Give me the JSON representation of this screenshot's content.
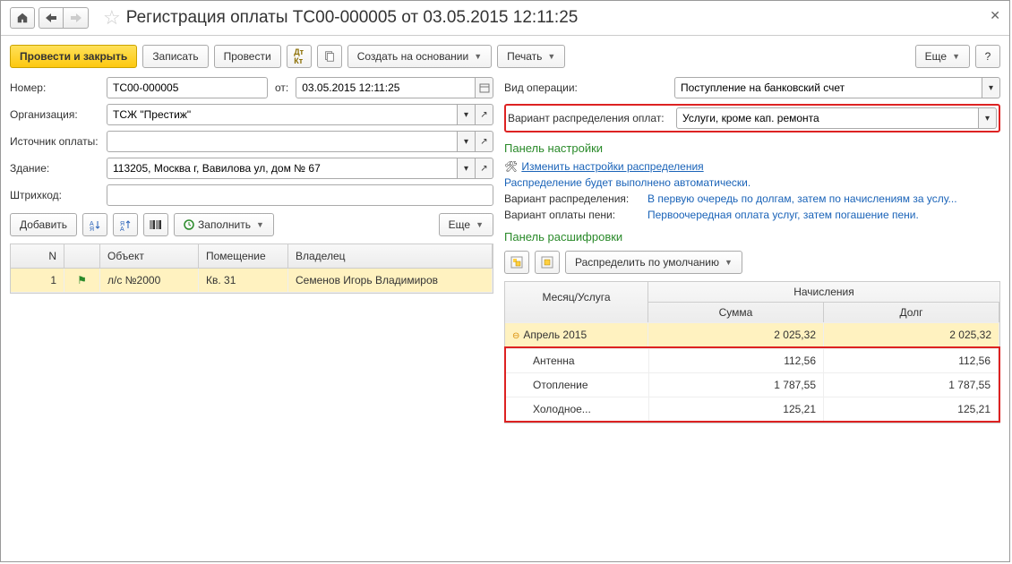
{
  "title": "Регистрация оплаты ТС00-000005 от 03.05.2015 12:11:25",
  "toolbar": {
    "run_close": "Провести и закрыть",
    "save": "Записать",
    "run": "Провести",
    "create_based": "Создать на основании",
    "print": "Печать",
    "more": "Еще"
  },
  "form": {
    "number_label": "Номер:",
    "number": "ТС00-000005",
    "from": "от:",
    "date": "03.05.2015 12:11:25",
    "op_type_label": "Вид операции:",
    "op_type": "Поступление на банковский счет",
    "org_label": "Организация:",
    "org": "ТСЖ \"Престиж\"",
    "dist_label": "Вариант распределения оплат:",
    "dist": "Услуги, кроме кап. ремонта",
    "source_label": "Источник оплаты:",
    "building_label": "Здание:",
    "building": "113205, Москва г, Вавилова ул, дом № 67",
    "barcode_label": "Штрихкод:"
  },
  "left_toolbar": {
    "add": "Добавить",
    "fill": "Заполнить",
    "more": "Еще"
  },
  "left_grid": {
    "cols": {
      "n": "N",
      "obj": "Объект",
      "room": "Помещение",
      "owner": "Владелец"
    },
    "rows": [
      {
        "n": "1",
        "obj": "л/с №2000",
        "room": "Кв. 31",
        "owner": "Семенов Игорь Владимиров"
      }
    ]
  },
  "right": {
    "panel_settings": "Панель настройки",
    "change_settings": "Изменить настройки распределения",
    "auto_note": "Распределение будет выполнено автоматически.",
    "dist_var_label": "Вариант распределения:",
    "dist_var_val": "В первую очередь по долгам, затем по начислениям за услу...",
    "peni_label": "Вариант оплаты пени:",
    "peni_val": "Первоочередная оплата услуг, затем погашение пени.",
    "panel_detail": "Панель расшифровки",
    "distribute_default": "Распределить по умолчанию"
  },
  "detail_grid": {
    "col1": "Месяц/Услуга",
    "col2_top": "Начисления",
    "col2a": "Сумма",
    "col2b": "Долг",
    "rows": [
      {
        "label": "Апрель 2015",
        "sum": "2 025,32",
        "debt": "2 025,32",
        "total": true
      },
      {
        "label": "Антенна",
        "sum": "112,56",
        "debt": "112,56"
      },
      {
        "label": "Отопление",
        "sum": "1 787,55",
        "debt": "1 787,55"
      },
      {
        "label": "Холодное...",
        "sum": "125,21",
        "debt": "125,21"
      }
    ]
  }
}
